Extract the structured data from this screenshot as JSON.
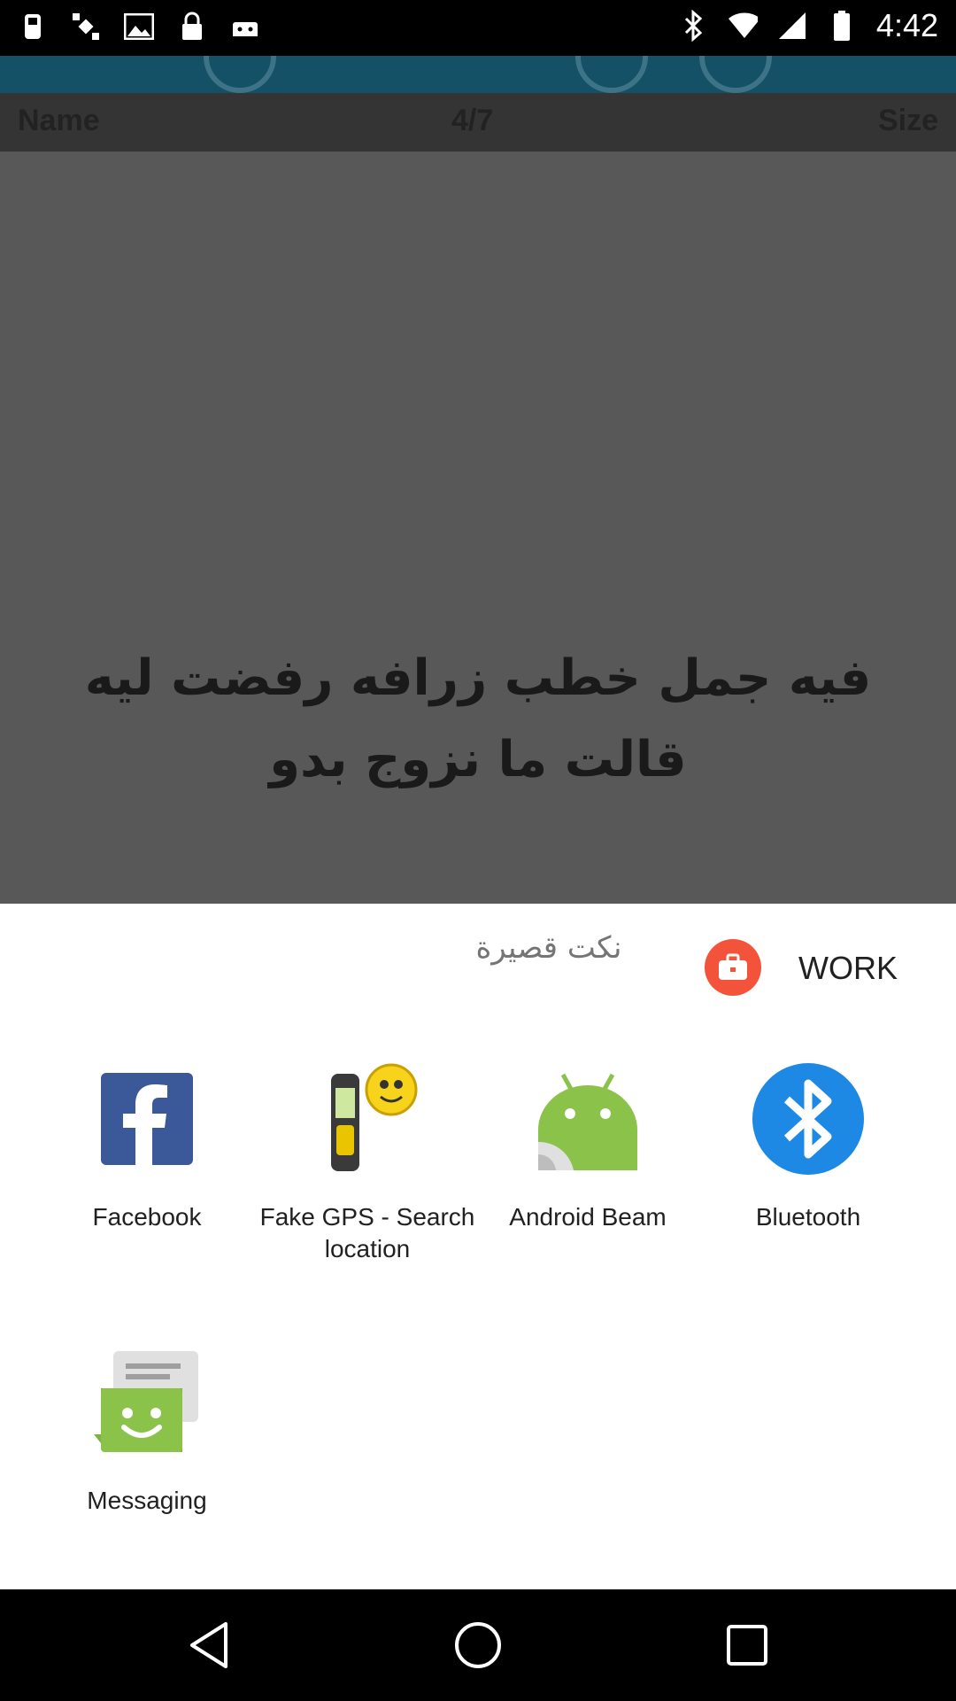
{
  "status_bar": {
    "time": "4:42",
    "left_icons": [
      "fake-gps-icon",
      "satellite-icon",
      "image-icon",
      "lock-icon",
      "android-icon"
    ],
    "right_icons": [
      "bluetooth-icon",
      "wifi-icon",
      "signal-icon",
      "battery-icon"
    ]
  },
  "background_app": {
    "header": {
      "name_label": "Name",
      "page_counter": "4/7",
      "size_label": "Size"
    },
    "content_text": "فيه جمل خطب زرافه رفضت ليه قالت ما نزوج بدو"
  },
  "share_sheet": {
    "title": "نكت قصيرة",
    "work_profile_label": "WORK",
    "apps": [
      {
        "label": "Facebook",
        "icon": "facebook-icon"
      },
      {
        "label": "Fake GPS - Search location",
        "icon": "fake-gps-icon"
      },
      {
        "label": "Android Beam",
        "icon": "android-beam-icon"
      },
      {
        "label": "Bluetooth",
        "icon": "bluetooth-icon"
      },
      {
        "label": "Messaging",
        "icon": "messaging-icon"
      }
    ]
  },
  "nav_bar": {
    "buttons": [
      "back-icon",
      "home-icon",
      "recents-icon"
    ]
  },
  "colors": {
    "facebook": "#3b5998",
    "android": "#8bc34a",
    "bluetooth": "#1e88e5",
    "work": "#f2533a"
  }
}
